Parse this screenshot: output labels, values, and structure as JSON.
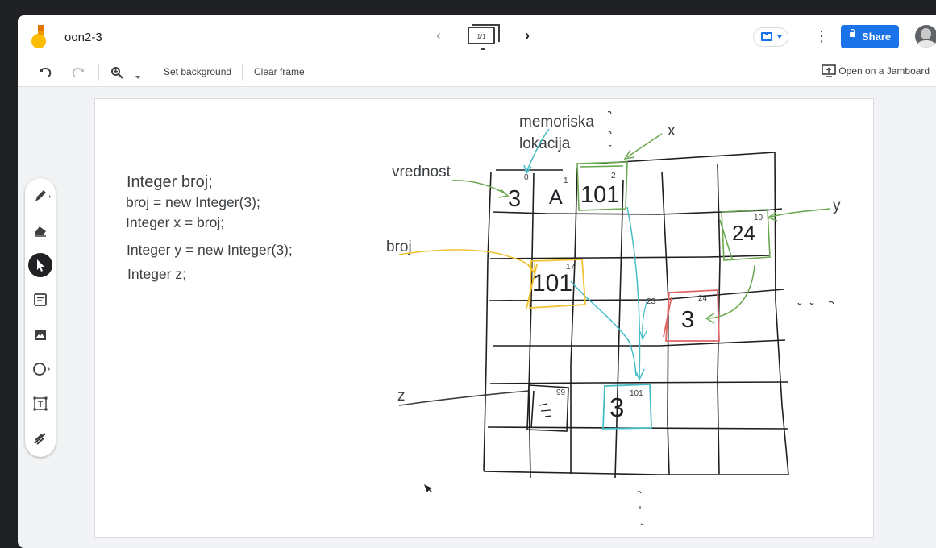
{
  "header": {
    "title": "oon2-3",
    "frame_indicator": "1/1",
    "share_label": "Share"
  },
  "toolbar": {
    "set_background": "Set background",
    "clear_frame": "Clear frame",
    "open_jamboard": "Open on a Jamboard"
  },
  "code": {
    "line1": "Integer broj;",
    "line2": "broj = new Integer(3);",
    "line3": "Integer x = broj;",
    "line4": "Integer y = new Integer(3);",
    "line5": "Integer z;"
  },
  "labels": {
    "memoriska": "memoriska",
    "lokacija": "lokacija",
    "vrednost": "vrednost",
    "x": "x",
    "y": "y",
    "broj": "broj",
    "z": "z"
  },
  "cells": {
    "v3": "3",
    "a": "A",
    "v101": "101",
    "v24": "24",
    "broj101": "101",
    "red3": "3",
    "teal3": "3"
  },
  "addresses": {
    "a0": "0",
    "a1": "1",
    "a2": "2",
    "a10": "10",
    "a17": "17",
    "a23": "23",
    "a24": "24",
    "a99": "99",
    "a101": "101"
  },
  "colors": {
    "brand_blue": "#1a73e8",
    "green": "#6aa84f",
    "orange": "#f1c232",
    "red": "#e06666",
    "teal": "#46bdc6"
  }
}
